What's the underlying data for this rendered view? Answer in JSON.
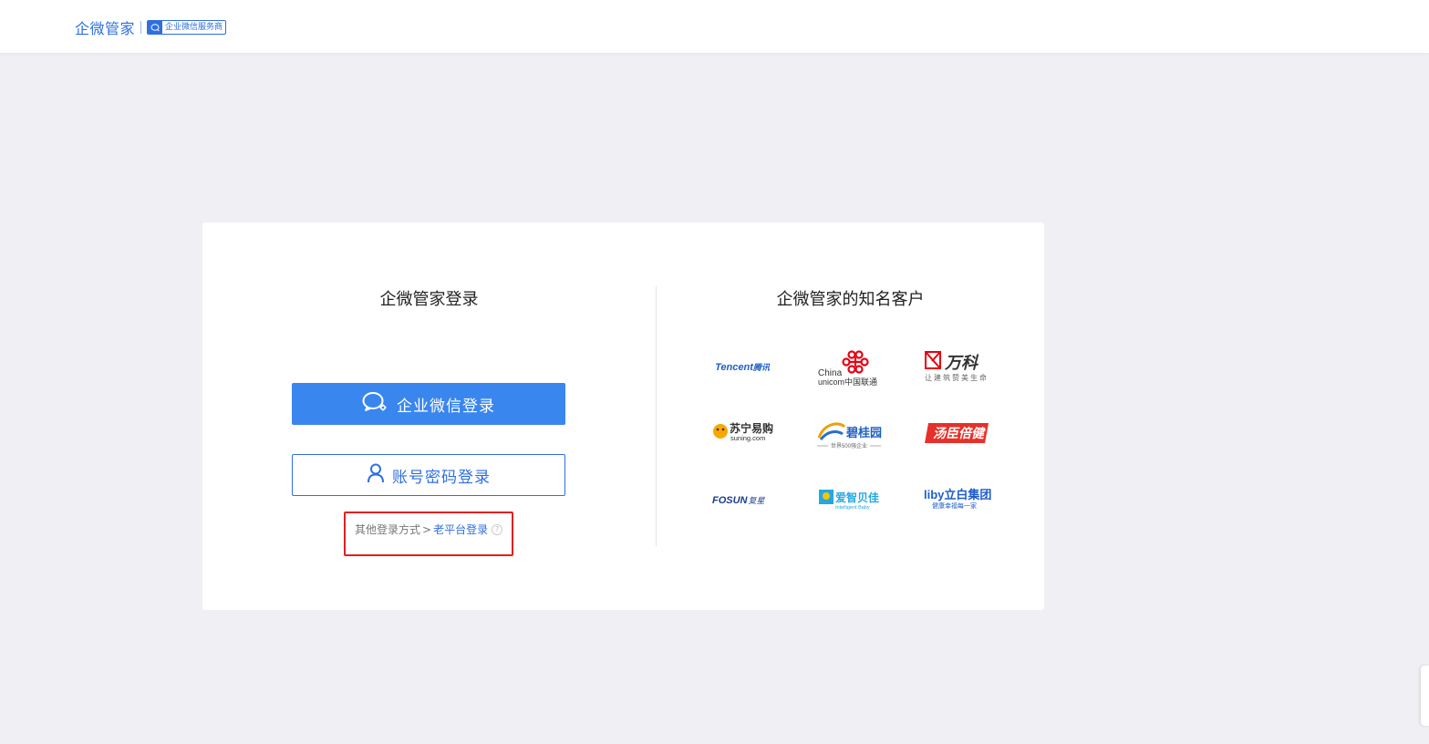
{
  "header": {
    "brand_name": "企微管家",
    "badge_text": "企业微信服务商"
  },
  "login": {
    "title": "企微管家登录",
    "wecom_button": "企业微信登录",
    "account_button": "账号密码登录",
    "other_label": "其他登录方式",
    "other_chevron": ">",
    "old_platform_link": "老平台登录",
    "help_icon": "?"
  },
  "clients": {
    "title": "企微管家的知名客户",
    "logos": [
      {
        "name": "Tencent 腾讯",
        "line1": "Tencent",
        "line2": "腾讯"
      },
      {
        "name": "China unicom 中国联通",
        "line1": "China",
        "line2": "unicom中国联通"
      },
      {
        "name": "万科",
        "line1": "万科",
        "line2": "让建筑赞美生命"
      },
      {
        "name": "苏宁易购",
        "line1": "苏宁易购",
        "line2": "suning.com"
      },
      {
        "name": "碧桂园",
        "line1": "碧桂园",
        "line2": "世界500强企业"
      },
      {
        "name": "汤臣倍健",
        "line1": "汤臣倍健",
        "line2": ""
      },
      {
        "name": "FOSUN 复星",
        "line1": "FOSUN",
        "line2": "复星"
      },
      {
        "name": "爱智贝佳",
        "line1": "爱智贝佳",
        "line2": "Intelligent Baby"
      },
      {
        "name": "liby 立白集团",
        "line1": "liby立白集团",
        "line2": "健康幸福每一家"
      }
    ]
  },
  "colors": {
    "accent": "#2f6fe0",
    "button_blue": "#3a86ef",
    "highlight_red": "#e02020",
    "background": "#f0f0f4"
  },
  "icons": [
    "wecom-chat-icon",
    "user-icon",
    "help-icon"
  ]
}
